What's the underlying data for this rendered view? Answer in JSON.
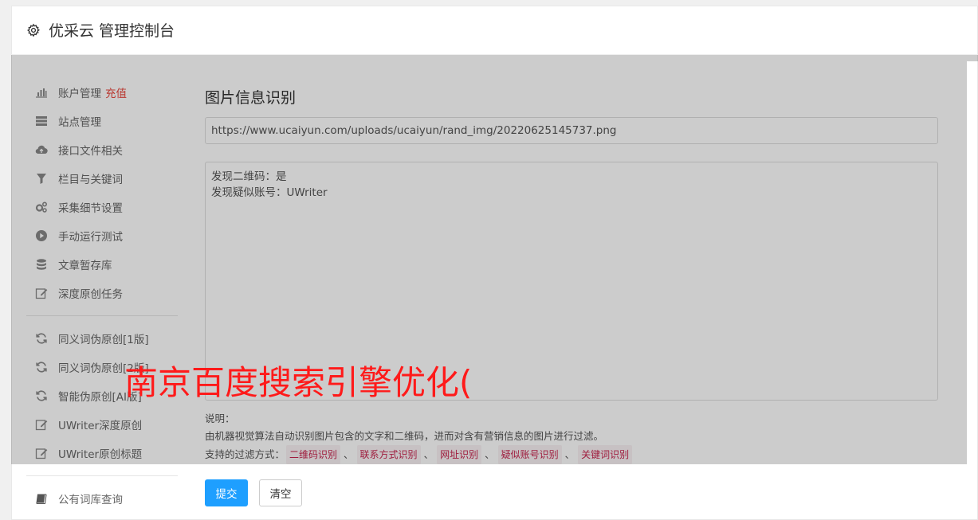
{
  "header": {
    "icon": "gear-icon",
    "title": "优采云 管理控制台"
  },
  "sidebar": {
    "groups": [
      [
        {
          "icon": "bar-chart-icon",
          "label": "账户管理",
          "tag": "充值"
        },
        {
          "icon": "server-icon",
          "label": "站点管理"
        },
        {
          "icon": "cloud-upload-icon",
          "label": "接口文件相关"
        },
        {
          "icon": "filter-icon",
          "label": "栏目与关键词"
        },
        {
          "icon": "gears-icon",
          "label": "采集细节设置"
        },
        {
          "icon": "play-circle-icon",
          "label": "手动运行测试"
        },
        {
          "icon": "database-icon",
          "label": "文章暂存库"
        },
        {
          "icon": "edit-icon",
          "label": "深度原创任务"
        }
      ],
      [
        {
          "icon": "refresh-icon",
          "label": "同义词伪原创[1版]"
        },
        {
          "icon": "refresh-icon",
          "label": "同义词伪原创[2版]"
        },
        {
          "icon": "refresh-icon",
          "label": "智能伪原创[AI版]"
        },
        {
          "icon": "edit-icon",
          "label": "UWriter深度原创"
        },
        {
          "icon": "edit-icon",
          "label": "UWriter原创标题"
        }
      ],
      [
        {
          "icon": "book-icon",
          "label": "公有词库查询"
        }
      ]
    ]
  },
  "main": {
    "title": "图片信息识别",
    "url_value": "https://www.ucaiyun.com/uploads/ucaiyun/rand_img/20220625145737.png",
    "result_lines": [
      "发现二维码：是",
      "发现疑似账号：UWriter"
    ],
    "notes": {
      "label": "说明：",
      "desc": "由机器视觉算法自动识别图片包含的文字和二维码，进而对含有营销信息的图片进行过滤。",
      "filters_label": "支持的过滤方式：",
      "filters": [
        "二维码识别",
        "联系方式识别",
        "网址识别",
        "疑似账号识别",
        "关键词识别"
      ],
      "separator": "、"
    },
    "buttons": {
      "submit": "提交",
      "clear": "清空"
    }
  },
  "watermark": "南京百度搜索引擎优化(",
  "colors": {
    "primary": "#1e9fff",
    "tag_red": "#e8463c",
    "chip_text": "#c7254e",
    "chip_bg": "#f9f2f4",
    "watermark": "#ff1a1a"
  }
}
